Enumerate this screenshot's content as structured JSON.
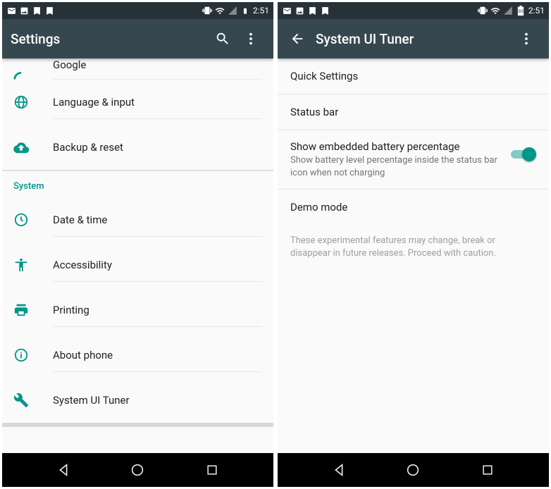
{
  "status": {
    "time": "2:51"
  },
  "left": {
    "title": "Settings",
    "cut_item": "Google",
    "items_top": [
      {
        "label": "Language & input"
      },
      {
        "label": "Backup & reset"
      }
    ],
    "section": "System",
    "items_system": [
      {
        "label": "Date & time"
      },
      {
        "label": "Accessibility"
      },
      {
        "label": "Printing"
      },
      {
        "label": "About phone"
      },
      {
        "label": "System UI Tuner"
      }
    ]
  },
  "right": {
    "title": "System UI Tuner",
    "items": [
      {
        "label": "Quick Settings"
      },
      {
        "label": "Status bar"
      }
    ],
    "switch": {
      "title": "Show embedded battery percentage",
      "subtitle": "Show battery level percentage inside the status bar icon when not charging",
      "on": true
    },
    "demo": "Demo mode",
    "footer": "These experimental features may change, break or disappear in future releases. Proceed with caution."
  }
}
